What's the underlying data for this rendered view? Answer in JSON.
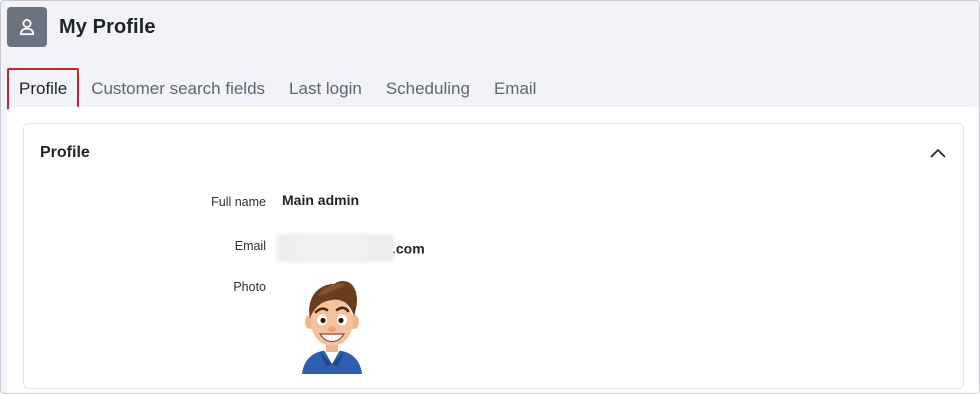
{
  "header": {
    "title": "My Profile",
    "icon": "user-icon"
  },
  "tabs": [
    {
      "label": "Profile",
      "active": true
    },
    {
      "label": "Customer search fields",
      "active": false
    },
    {
      "label": "Last login",
      "active": false
    },
    {
      "label": "Scheduling",
      "active": false
    },
    {
      "label": "Email",
      "active": false
    }
  ],
  "profile_card": {
    "title": "Profile",
    "fields": {
      "full_name": {
        "label": "Full name",
        "value": "Main admin"
      },
      "email": {
        "label": "Email",
        "value_visible": ".com"
      },
      "photo": {
        "label": "Photo"
      }
    }
  },
  "colors": {
    "active_tab_border": "#c0282d",
    "avatar_tile": "#6b7280",
    "page_bg": "#f2f3f8"
  }
}
